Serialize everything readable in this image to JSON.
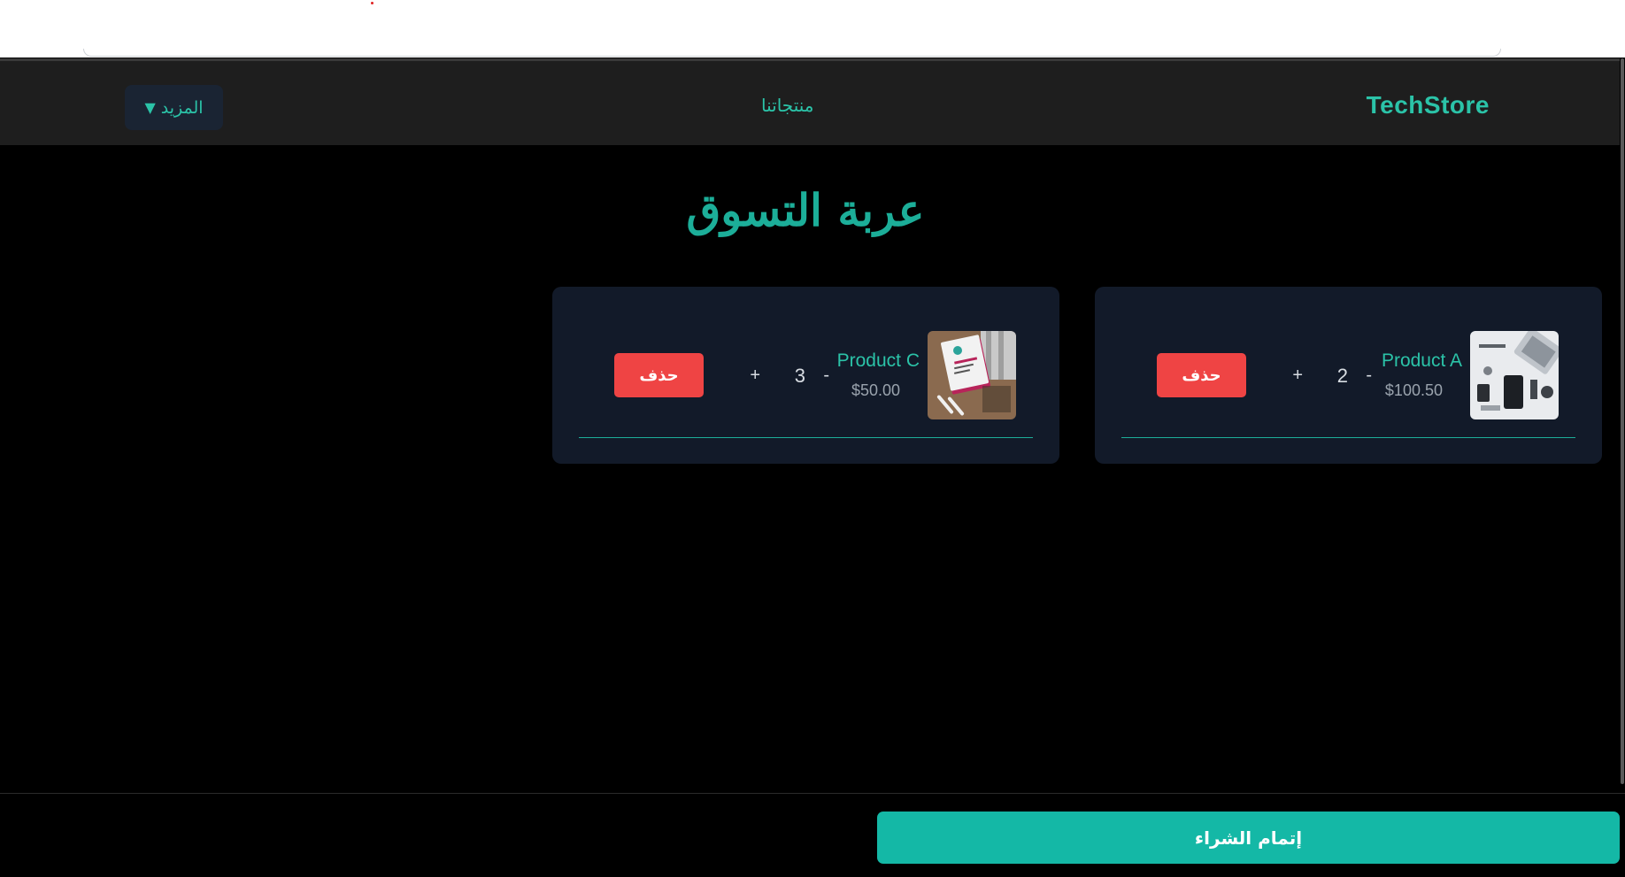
{
  "navbar": {
    "brand": "TechStore",
    "products_link": "منتجاتنا",
    "more_label": "المزيد",
    "more_caret": "▼"
  },
  "cart": {
    "title": "عربة التسوق",
    "items": [
      {
        "name": "Product A",
        "price": "$100.50",
        "quantity": "2",
        "minus": "-",
        "plus": "+",
        "delete_label": "حذف",
        "image": "laptop-desk-photo"
      },
      {
        "name": "Product C",
        "price": "$50.00",
        "quantity": "3",
        "minus": "-",
        "plus": "+",
        "delete_label": "حذف",
        "image": "book-cover-photo"
      }
    ]
  },
  "checkout": {
    "label": "إتمام الشراء"
  },
  "colors": {
    "accent": "#2bc3a8",
    "checkout": "#14b8a6",
    "delete": "#ef4444",
    "card_bg": "#121a29",
    "navbar_bg": "#1e1e1e"
  }
}
